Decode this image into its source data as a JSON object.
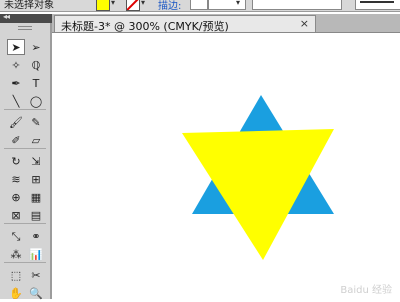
{
  "control_bar": {
    "selection_status": "未选择对象",
    "fill_color": "#ffff00",
    "stroke_label": "描边:"
  },
  "tools_panel": {
    "collapse_glyph": "◂◂",
    "tools": [
      {
        "name": "selection-tool",
        "icon": "selection-arrow-icon",
        "glyph": "➤"
      },
      {
        "name": "direct-selection-tool",
        "icon": "direct-selection-arrow-icon",
        "glyph": "➢"
      },
      {
        "name": "magic-wand-tool",
        "icon": "magic-wand-icon",
        "glyph": "✧"
      },
      {
        "name": "lasso-tool",
        "icon": "lasso-icon",
        "glyph": "ℚ"
      },
      {
        "name": "pen-tool",
        "icon": "pen-nib-icon",
        "glyph": "✒"
      },
      {
        "name": "type-tool",
        "icon": "type-t-icon",
        "glyph": "T"
      },
      {
        "name": "line-segment-tool",
        "icon": "line-segment-icon",
        "glyph": "╲"
      },
      {
        "name": "ellipse-tool",
        "icon": "ellipse-icon",
        "glyph": "◯"
      },
      {
        "name": "paintbrush-tool",
        "icon": "paintbrush-icon",
        "glyph": "🖌"
      },
      {
        "name": "pencil-tool",
        "icon": "pencil-icon",
        "glyph": "✎"
      },
      {
        "name": "blob-brush-tool",
        "icon": "blob-brush-icon",
        "glyph": "✐"
      },
      {
        "name": "eraser-tool",
        "icon": "eraser-icon",
        "glyph": "▱"
      },
      {
        "name": "rotate-tool",
        "icon": "rotate-icon",
        "glyph": "↻"
      },
      {
        "name": "scale-tool",
        "icon": "scale-icon",
        "glyph": "⇲"
      },
      {
        "name": "warp-tool",
        "icon": "warp-icon",
        "glyph": "≋"
      },
      {
        "name": "free-transform-tool",
        "icon": "free-transform-icon",
        "glyph": "⊞"
      },
      {
        "name": "shape-builder-tool",
        "icon": "shape-builder-icon",
        "glyph": "⊕"
      },
      {
        "name": "perspective-grid-tool",
        "icon": "perspective-grid-icon",
        "glyph": "▦"
      },
      {
        "name": "mesh-tool",
        "icon": "mesh-icon",
        "glyph": "⊠"
      },
      {
        "name": "gradient-tool",
        "icon": "gradient-icon",
        "glyph": "▤"
      },
      {
        "name": "eyedropper-tool",
        "icon": "eyedropper-icon",
        "glyph": "⤡"
      },
      {
        "name": "blend-tool",
        "icon": "blend-icon",
        "glyph": "⚭"
      },
      {
        "name": "symbol-sprayer-tool",
        "icon": "symbol-sprayer-icon",
        "glyph": "⁂"
      },
      {
        "name": "column-graph-tool",
        "icon": "column-graph-icon",
        "glyph": "📊"
      },
      {
        "name": "artboard-tool",
        "icon": "artboard-icon",
        "glyph": "⬚"
      },
      {
        "name": "slice-tool",
        "icon": "slice-knife-icon",
        "glyph": "✂"
      },
      {
        "name": "hand-tool",
        "icon": "hand-icon",
        "glyph": "✋"
      },
      {
        "name": "zoom-tool",
        "icon": "zoom-magnifier-icon",
        "glyph": "🔍"
      }
    ]
  },
  "document": {
    "tab_title": "未标题-3* @ 300% (CMYK/预览)",
    "close_glyph": "×"
  },
  "artwork": {
    "back_triangle_color": "#1a9fe0",
    "front_triangle_color": "#ffff00"
  },
  "watermark": "Baidu 经验"
}
